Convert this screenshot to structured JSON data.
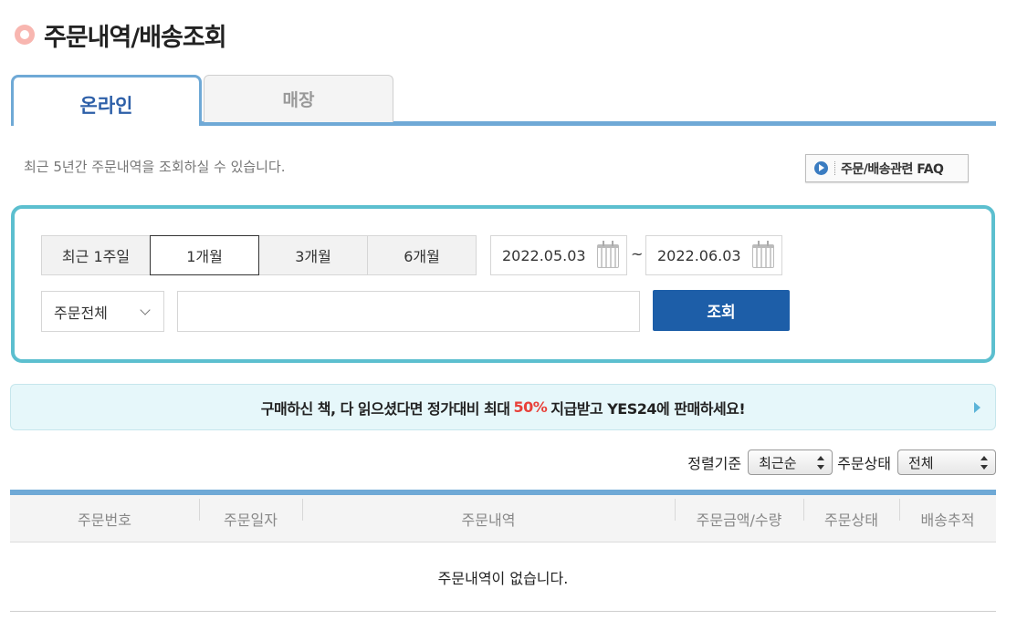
{
  "page": {
    "title": "주문내역/배송조회"
  },
  "tabs": [
    {
      "label": "온라인",
      "active": true
    },
    {
      "label": "매장",
      "active": false
    }
  ],
  "notice": "최근 5년간 주문내역을 조회하실 수 있습니다.",
  "faq_button": "주문/배송관련 FAQ",
  "search": {
    "periods": [
      {
        "label": "최근 1주일",
        "selected": false
      },
      {
        "label": "1개월",
        "selected": true
      },
      {
        "label": "3개월",
        "selected": false
      },
      {
        "label": "6개월",
        "selected": false
      }
    ],
    "date_from": "2022.05.03",
    "date_separator": "~",
    "date_to": "2022.06.03",
    "order_type": "주문전체",
    "keyword": "",
    "submit_label": "조회"
  },
  "banner": {
    "text_before": "구매하신 책, 다 읽으셨다면 정가대비 최대",
    "highlight": "50%",
    "text_after": "지급받고 YES24에 판매하세요!"
  },
  "sort": {
    "sort_label": "정렬기준",
    "sort_value": "최근순",
    "status_label": "주문상태",
    "status_value": "전체"
  },
  "table": {
    "columns": [
      "주문번호",
      "주문일자",
      "주문내역",
      "주문금액/수량",
      "주문상태",
      "배송추적"
    ],
    "empty_message": "주문내역이 없습니다."
  },
  "colors": {
    "accent_blue": "#1d5ea8",
    "tab_line": "#6fa9d6",
    "search_border": "#5cbfcf",
    "banner_highlight": "#e8413a"
  }
}
